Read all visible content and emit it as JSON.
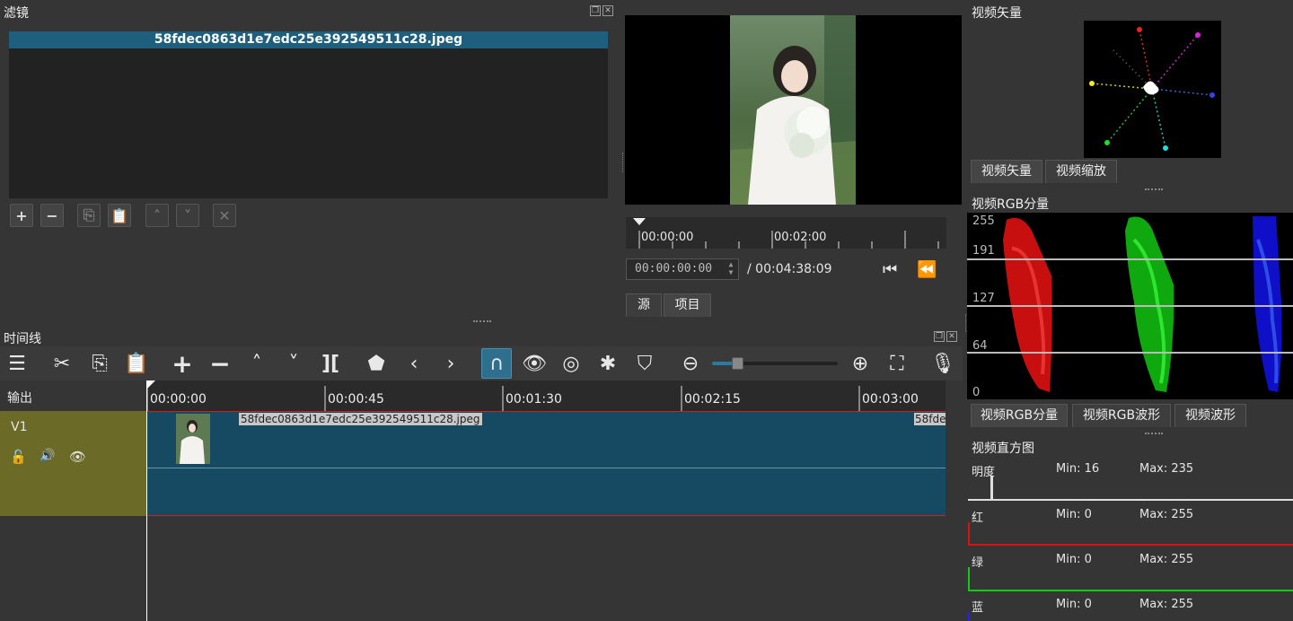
{
  "filters": {
    "title": "滤镜",
    "selected_item": "58fdec0863d1e7edc25e392549511c28.jpeg"
  },
  "player": {
    "ruler_labels": [
      "00:00:00",
      "00:02:00"
    ],
    "timecode_value": "00:00:00:00",
    "duration": "/ 00:04:38:09",
    "tabs": [
      "源",
      "项目"
    ]
  },
  "vectorscope": {
    "title": "视频矢量",
    "tabs": [
      "视频矢量",
      "视频缩放"
    ]
  },
  "rgb_parade": {
    "title": "视频RGB分量",
    "levels": [
      "255",
      "191",
      "127",
      "64",
      "0"
    ],
    "tabs": [
      "视频RGB分量",
      "视频RGB波形",
      "视频波形"
    ]
  },
  "histogram": {
    "title": "视频直方图",
    "rows": [
      {
        "label": "明度",
        "min": "Min: 16",
        "max": "Max: 235",
        "color": "#e0e0e0"
      },
      {
        "label": "红",
        "min": "Min: 0",
        "max": "Max: 255",
        "color": "#e01a1a"
      },
      {
        "label": "绿",
        "min": "Min: 0",
        "max": "Max: 255",
        "color": "#1adf1a"
      },
      {
        "label": "蓝",
        "min": "Min: 0",
        "max": "Max: 255",
        "color": "#2233ff"
      }
    ]
  },
  "timeline": {
    "title": "时间线",
    "output_label": "输出",
    "track_name": "V1",
    "ruler_labels": [
      "00:00:00",
      "00:00:45",
      "00:01:30",
      "00:02:15",
      "00:03:00"
    ],
    "clip_name": "58fdec0863d1e7edc25e392549511c28.jpeg",
    "clip_name_truncated": "58fde"
  },
  "colors": {
    "accent": "#1d5f7c",
    "track_header": "#6b6b27",
    "clip_bg": "#154a62",
    "snap_active": "#2d6f8c"
  }
}
